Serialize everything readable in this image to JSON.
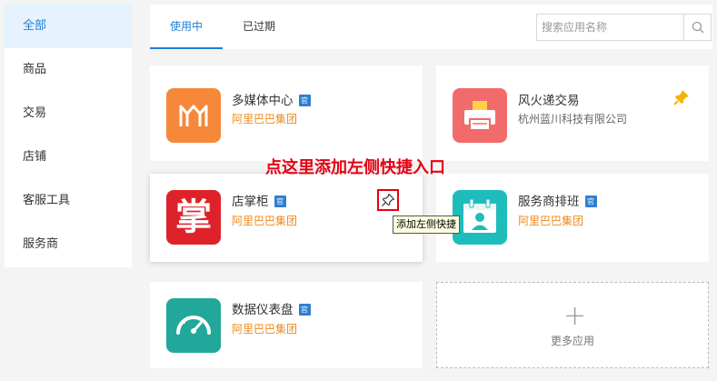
{
  "sidebar": {
    "items": [
      {
        "label": "全部",
        "active": true
      },
      {
        "label": "商品"
      },
      {
        "label": "交易"
      },
      {
        "label": "店铺"
      },
      {
        "label": "客服工具"
      },
      {
        "label": "服务商"
      }
    ]
  },
  "tabs": [
    {
      "label": "使用中",
      "active": true
    },
    {
      "label": "已过期"
    }
  ],
  "search": {
    "placeholder": "搜索应用名称",
    "value": ""
  },
  "official_badge": "官",
  "apps": [
    {
      "name": "多媒体中心",
      "vendor": "阿里巴巴集团",
      "official": true,
      "icon": "multimedia-m-icon",
      "color": "#f5883a"
    },
    {
      "name": "风火递交易",
      "vendor": "杭州蓝川科技有限公司",
      "official": false,
      "icon": "printer-icon",
      "color": "#f26b6b",
      "pinned": true
    },
    {
      "name": "店掌柜",
      "vendor": "阿里巴巴集团",
      "official": true,
      "icon": "zhang-char-icon",
      "icon_text": "掌",
      "color": "#de2229"
    },
    {
      "name": "服务商排班",
      "vendor": "阿里巴巴集团",
      "official": true,
      "icon": "calendar-person-icon",
      "color": "#1fbcbc"
    },
    {
      "name": "数据仪表盘",
      "vendor": "阿里巴巴集团",
      "official": true,
      "icon": "speedometer-icon",
      "color": "#21a89a"
    }
  ],
  "more_apps_label": "更多应用",
  "annotation": "点这里添加左侧快捷入口",
  "tooltip": "添加左侧快捷",
  "colors": {
    "accent": "#1c7fd9",
    "vendor": "#f08a1c",
    "highlight": "#e60012",
    "pin": "#f5b400"
  }
}
